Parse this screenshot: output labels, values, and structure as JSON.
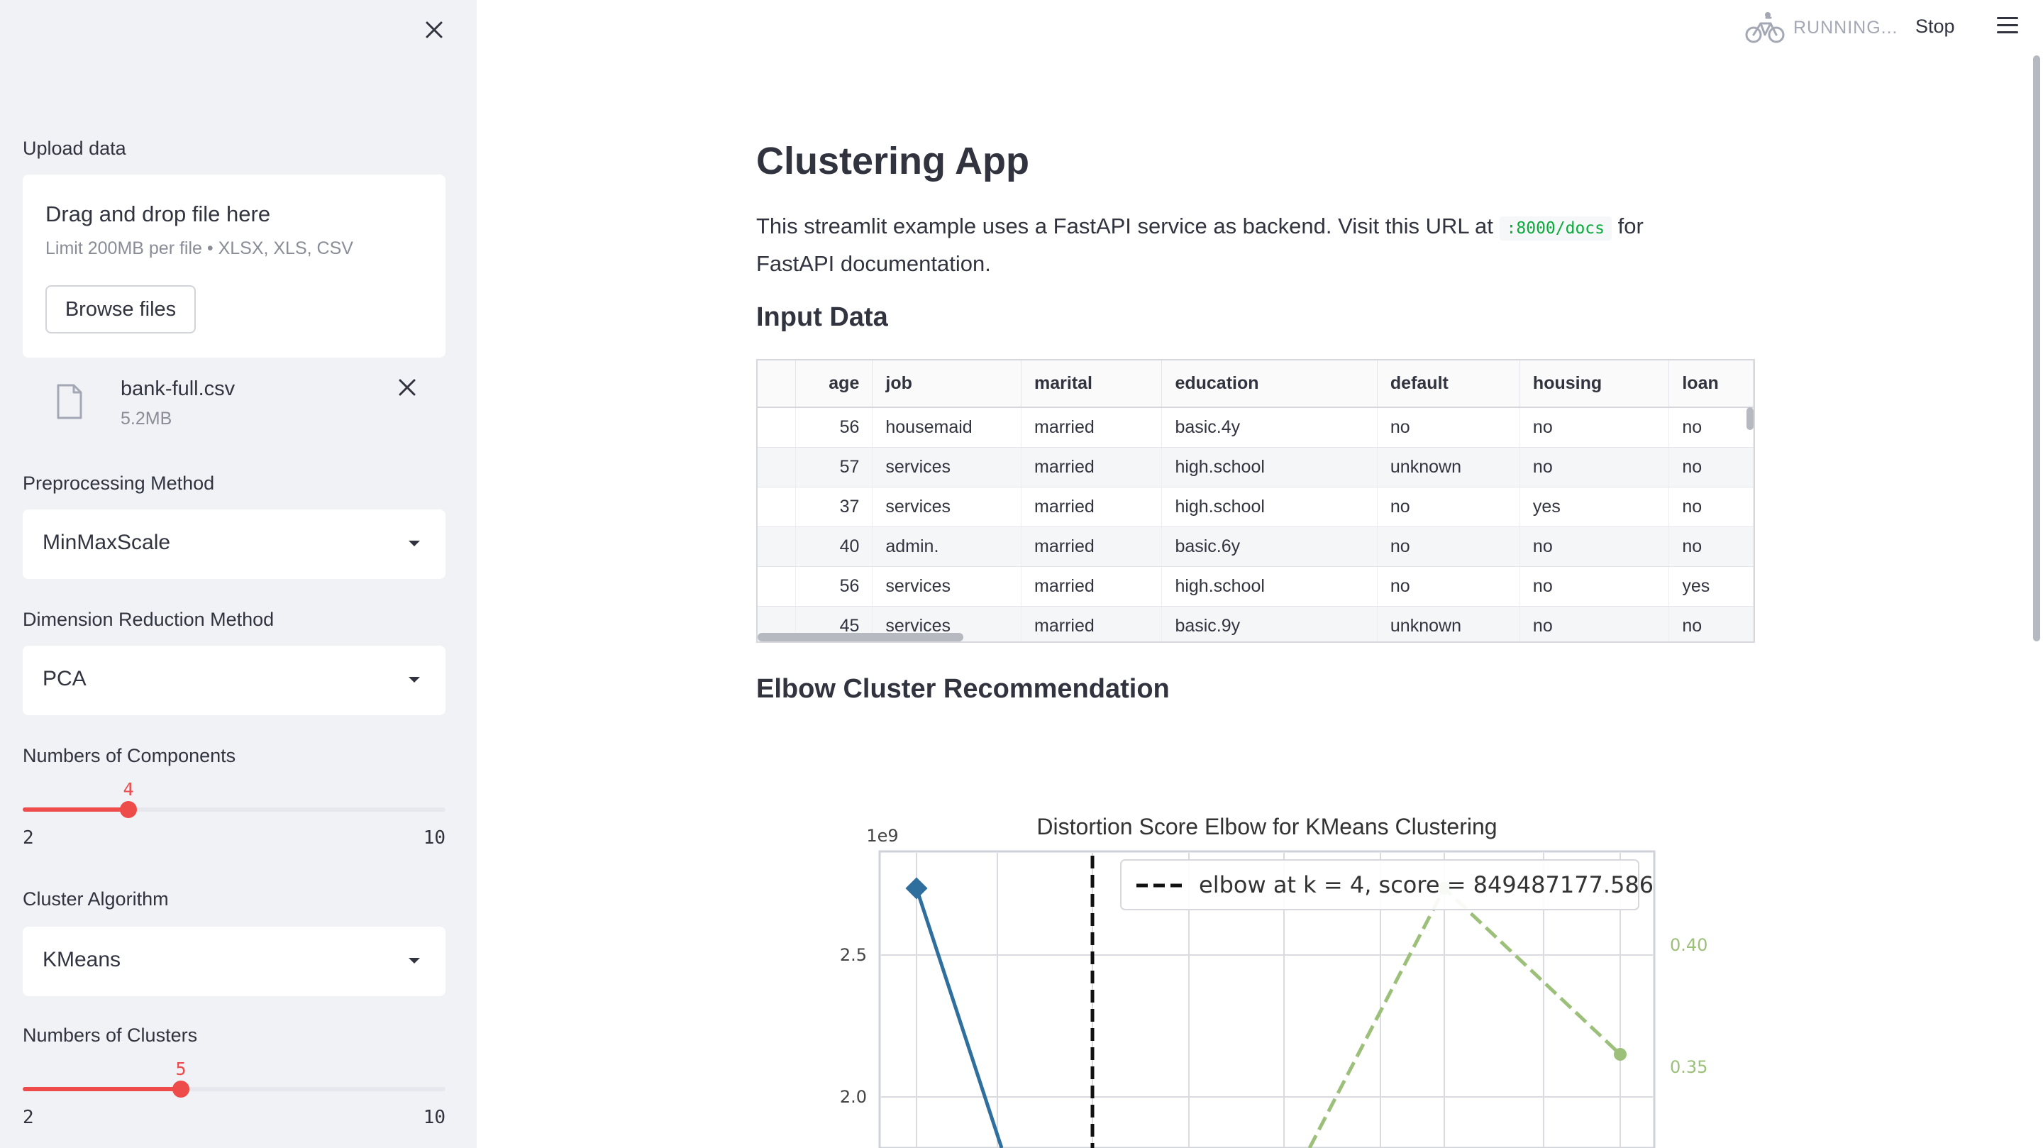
{
  "sidebar": {
    "upload_label": "Upload data",
    "uploader": {
      "title": "Drag and drop file here",
      "limit": "Limit 200MB per file • XLSX, XLS, CSV",
      "browse_label": "Browse files"
    },
    "file": {
      "name": "bank-full.csv",
      "size": "5.2MB"
    },
    "preprocessing": {
      "label": "Preprocessing Method",
      "value": "MinMaxScale"
    },
    "dim_reduction": {
      "label": "Dimension Reduction Method",
      "value": "PCA"
    },
    "components": {
      "label": "Numbers of Components",
      "value": "4",
      "min": "2",
      "max": "10"
    },
    "cluster_algo": {
      "label": "Cluster Algorithm",
      "value": "KMeans"
    },
    "clusters": {
      "label": "Numbers of Clusters",
      "value": "5",
      "min": "2",
      "max": "10"
    }
  },
  "topbar": {
    "status": "RUNNING...",
    "stop_label": "Stop"
  },
  "main": {
    "title": "Clustering App",
    "intro_pre": "This streamlit example uses a FastAPI service as backend. Visit this URL at ",
    "intro_code": ":8000/docs",
    "intro_post": " for FastAPI documentation.",
    "input_heading": "Input Data",
    "elbow_heading": "Elbow Cluster Recommendation"
  },
  "table": {
    "columns": [
      "",
      "age",
      "job",
      "marital",
      "education",
      "default",
      "housing",
      "loan"
    ],
    "rows": [
      [
        "",
        "56",
        "housemaid",
        "married",
        "basic.4y",
        "no",
        "no",
        "no"
      ],
      [
        "",
        "57",
        "services",
        "married",
        "high.school",
        "unknown",
        "no",
        "no"
      ],
      [
        "",
        "37",
        "services",
        "married",
        "high.school",
        "no",
        "yes",
        "no"
      ],
      [
        "",
        "40",
        "admin.",
        "married",
        "basic.6y",
        "no",
        "no",
        "no"
      ],
      [
        "",
        "56",
        "services",
        "married",
        "high.school",
        "no",
        "no",
        "yes"
      ],
      [
        "",
        "45",
        "services",
        "married",
        "basic.9y",
        "unknown",
        "no",
        "no"
      ]
    ]
  },
  "chart_data": {
    "type": "line",
    "title": "Distortion Score Elbow for KMeans Clustering",
    "y_offset_label": "1e9",
    "y_ticks": [
      "2.5",
      "2.0"
    ],
    "y2_ticks": [
      "0.40",
      "0.35"
    ],
    "legend": "elbow at k = 4, score = 849487177.586",
    "elbow_k": 4,
    "colors": {
      "distortion": "#2e6f9e",
      "fit_time": "#9cbf7a",
      "elbow": "#111111"
    }
  }
}
